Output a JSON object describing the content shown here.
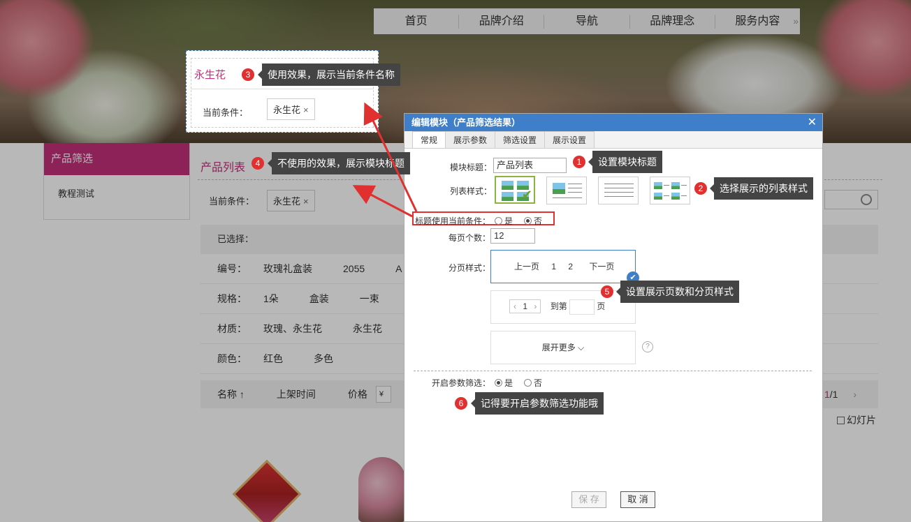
{
  "topnav": {
    "items": [
      "首页",
      "品牌介绍",
      "导航",
      "品牌理念",
      "服务内容"
    ],
    "more": "»"
  },
  "sidebar": {
    "title": "产品筛选",
    "items": [
      "教程测试"
    ]
  },
  "main": {
    "title": "产品列表",
    "current_condition_label": "当前条件：",
    "current_tag": "永生花",
    "tag_remove": "×",
    "selected_label": "已选择：",
    "attributes": [
      {
        "label": "编号：",
        "values": [
          "玫瑰礼盒装",
          "2055",
          "A"
        ]
      },
      {
        "label": "规格：",
        "values": [
          "1朵",
          "盒装",
          "一束"
        ]
      },
      {
        "label": "材质：",
        "values": [
          "玫瑰、永生花",
          "永生花"
        ]
      },
      {
        "label": "颜色：",
        "values": [
          "红色",
          "多色"
        ]
      }
    ],
    "sort": {
      "name": "名称 ↑",
      "time": "上架时间",
      "price": "价格",
      "price_input": "¥"
    },
    "page_current": "1",
    "page_total": "/1",
    "page_next": "›",
    "slideshow": "幻灯片"
  },
  "preview": {
    "title": "永生花",
    "condition_label": "当前条件：",
    "tag": "永生花",
    "tag_remove": "×"
  },
  "callouts": [
    {
      "num": "1",
      "text": "设置模块标题"
    },
    {
      "num": "2",
      "text": "选择展示的列表样式"
    },
    {
      "num": "3",
      "text": "使用效果，展示当前条件名称"
    },
    {
      "num": "4",
      "text": "不使用的效果，展示模块标题"
    },
    {
      "num": "5",
      "text": "设置展示页数和分页样式"
    },
    {
      "num": "6",
      "text": "记得要开启参数筛选功能哦"
    }
  ],
  "dialog": {
    "title": "编辑模块（产品筛选结果）",
    "close": "✕",
    "tabs": [
      "常规",
      "展示参数",
      "筛选设置",
      "展示设置"
    ],
    "module_title_label": "模块标题：",
    "module_title_value": "产品列表",
    "list_style_label": "列表样式：",
    "use_condition_label": "标题使用当前条件：",
    "yes": "是",
    "no": "否",
    "per_page_label": "每页个数：",
    "per_page_value": "12",
    "pager_style_label": "分页样式：",
    "pager1": {
      "prev": "上一页",
      "p1": "1",
      "p2": "2",
      "next": "下一页"
    },
    "pager2": {
      "prev": "‹",
      "cur": "1",
      "next": "›",
      "goto": "到第",
      "page": "页"
    },
    "expand_more": "展开更多 ⌵",
    "help": "?",
    "param_filter_label": "开启参数筛选：",
    "save": "保 存",
    "cancel": "取 消"
  },
  "colors": {
    "accent": "#c2307b",
    "dialog_head": "#3f7fc9",
    "callout_badge": "#e03030"
  }
}
